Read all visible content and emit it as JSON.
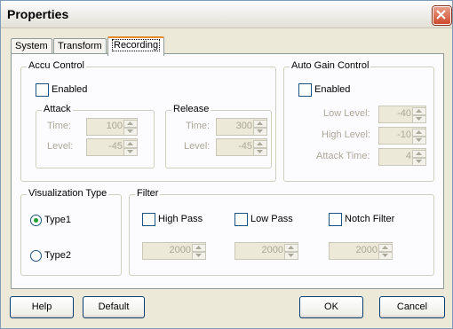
{
  "window": {
    "title": "Properties"
  },
  "tabs": [
    {
      "label": "System"
    },
    {
      "label": "Transform"
    },
    {
      "label": "Recording"
    }
  ],
  "accu_control": {
    "title": "Accu Control",
    "enabled_label": "Enabled",
    "attack": {
      "title": "Attack",
      "time_label": "Time:",
      "time_value": "100",
      "level_label": "Level:",
      "level_value": "-45"
    },
    "release": {
      "title": "Release",
      "time_label": "Time:",
      "time_value": "300",
      "level_label": "Level:",
      "level_value": "-45"
    }
  },
  "auto_gain": {
    "title": "Auto Gain Control",
    "enabled_label": "Enabled",
    "low_level_label": "Low Level:",
    "low_level_value": "-40",
    "high_level_label": "High Level:",
    "high_level_value": "-10",
    "attack_time_label": "Attack Time:",
    "attack_time_value": "4"
  },
  "visualization": {
    "title": "Visualization Type",
    "type1_label": "Type1",
    "type2_label": "Type2",
    "selected": "Type1"
  },
  "filter": {
    "title": "Filter",
    "high_pass_label": "High Pass",
    "high_pass_value": "2000",
    "low_pass_label": "Low Pass",
    "low_pass_value": "2000",
    "notch_label": "Notch Filter",
    "notch_value": "2000"
  },
  "buttons": {
    "help": "Help",
    "default": "Default",
    "ok": "OK",
    "cancel": "Cancel"
  }
}
